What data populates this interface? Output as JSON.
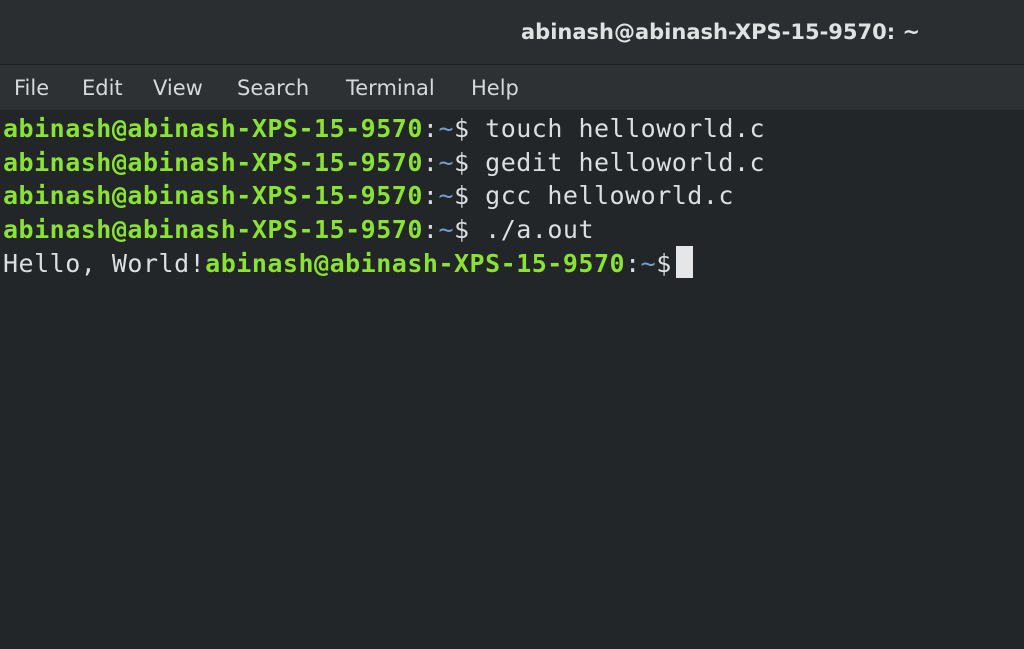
{
  "window": {
    "title": "abinash@abinash-XPS-15-9570: ~"
  },
  "menu": {
    "items": [
      "File",
      "Edit",
      "View",
      "Search",
      "Terminal",
      "Help"
    ]
  },
  "terminal": {
    "prompt": {
      "user_host": "abinash@abinash-XPS-15-9570",
      "separator": ":",
      "directory": "~",
      "sign": "$"
    },
    "lines": [
      {
        "command": "touch helloworld.c"
      },
      {
        "command": "gedit helloworld.c"
      },
      {
        "command": "gcc helloworld.c"
      },
      {
        "command": "./a.out"
      }
    ],
    "last_output": "Hello, World!",
    "colors": {
      "user_host": "#8ae234",
      "directory": "#729fcf",
      "background": "#232628"
    }
  }
}
